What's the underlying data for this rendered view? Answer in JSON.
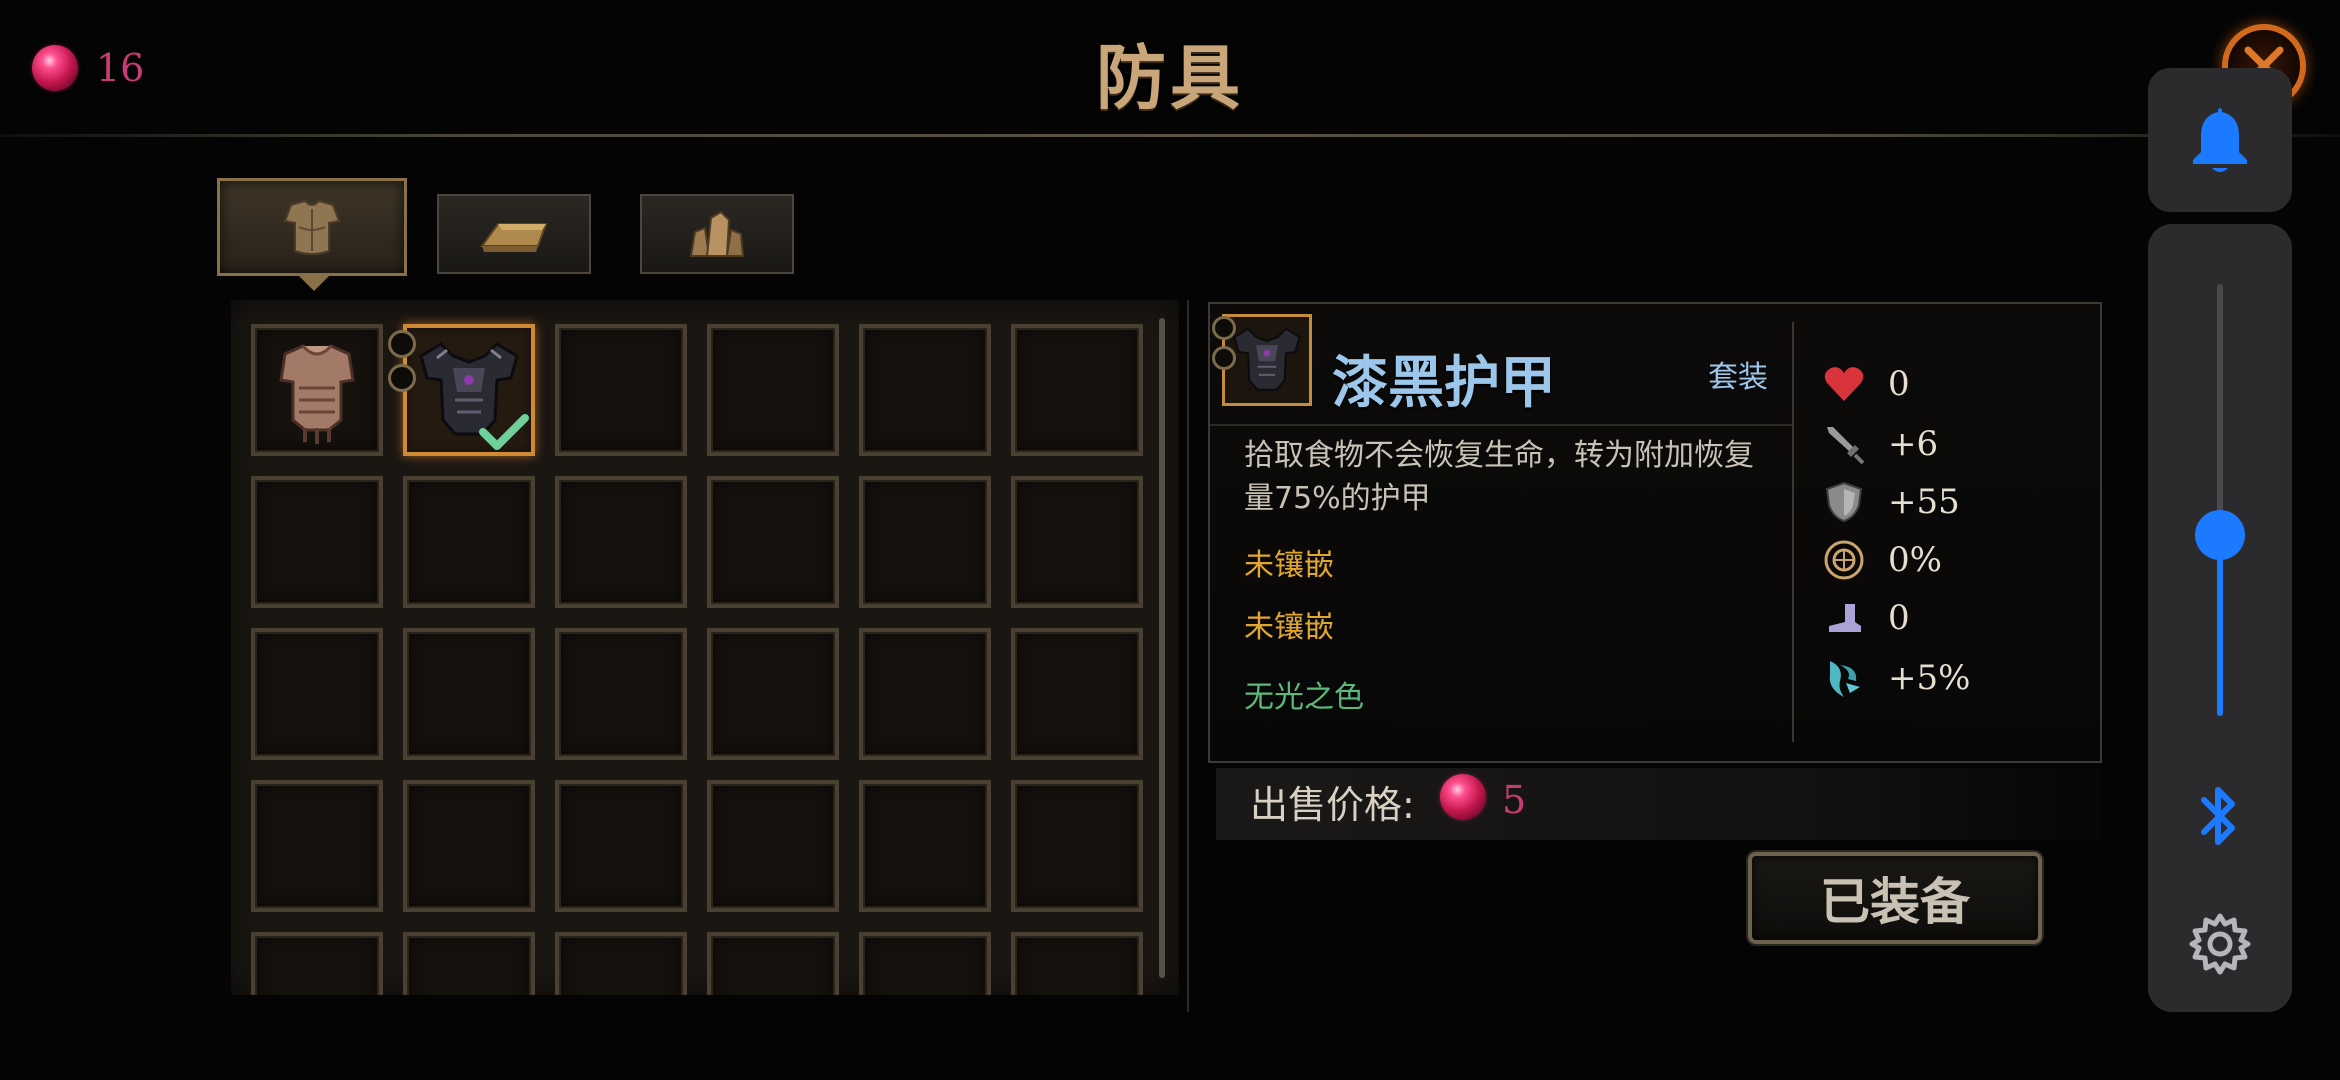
{
  "header": {
    "title": "防具",
    "currency_count": "16"
  },
  "tabs": [
    {
      "name": "armor",
      "icon": "armor-icon",
      "active": true
    },
    {
      "name": "gold",
      "icon": "gold-bar-icon",
      "active": false
    },
    {
      "name": "crystal",
      "icon": "crystal-icon",
      "active": false
    }
  ],
  "inventory": {
    "items": [
      {
        "name": "leather-armor",
        "icon": "leather-armor-icon",
        "equipped": false
      },
      {
        "name": "dark-armor",
        "icon": "dark-armor-icon",
        "equipped": true
      }
    ]
  },
  "detail": {
    "name": "漆黑护甲",
    "set_label": "套装",
    "description": "拾取食物不会恢复生命，转为附加恢复量75%的护甲",
    "sockets": [
      "未镶嵌",
      "未镶嵌"
    ],
    "effect": "无光之色",
    "stats": [
      {
        "icon": "heart-icon",
        "value": "0"
      },
      {
        "icon": "sword-icon",
        "value": "+6"
      },
      {
        "icon": "shield-icon",
        "value": "+55"
      },
      {
        "icon": "crit-icon",
        "value": "0%"
      },
      {
        "icon": "boot-icon",
        "value": "0"
      },
      {
        "icon": "claw-icon",
        "value": "+5%"
      }
    ]
  },
  "sell": {
    "label": "出售价格:",
    "value": "5"
  },
  "equip_button": {
    "label": "已装备"
  },
  "system_panel": {
    "volume_level": 0.42
  },
  "colors": {
    "title_gold": "#c8a679",
    "item_name_blue": "#9cc6ea",
    "socket_yellow": "#e0a72e",
    "effect_green": "#5cb97a",
    "gem_pink": "#c73b74",
    "system_blue": "#1c7aff"
  }
}
